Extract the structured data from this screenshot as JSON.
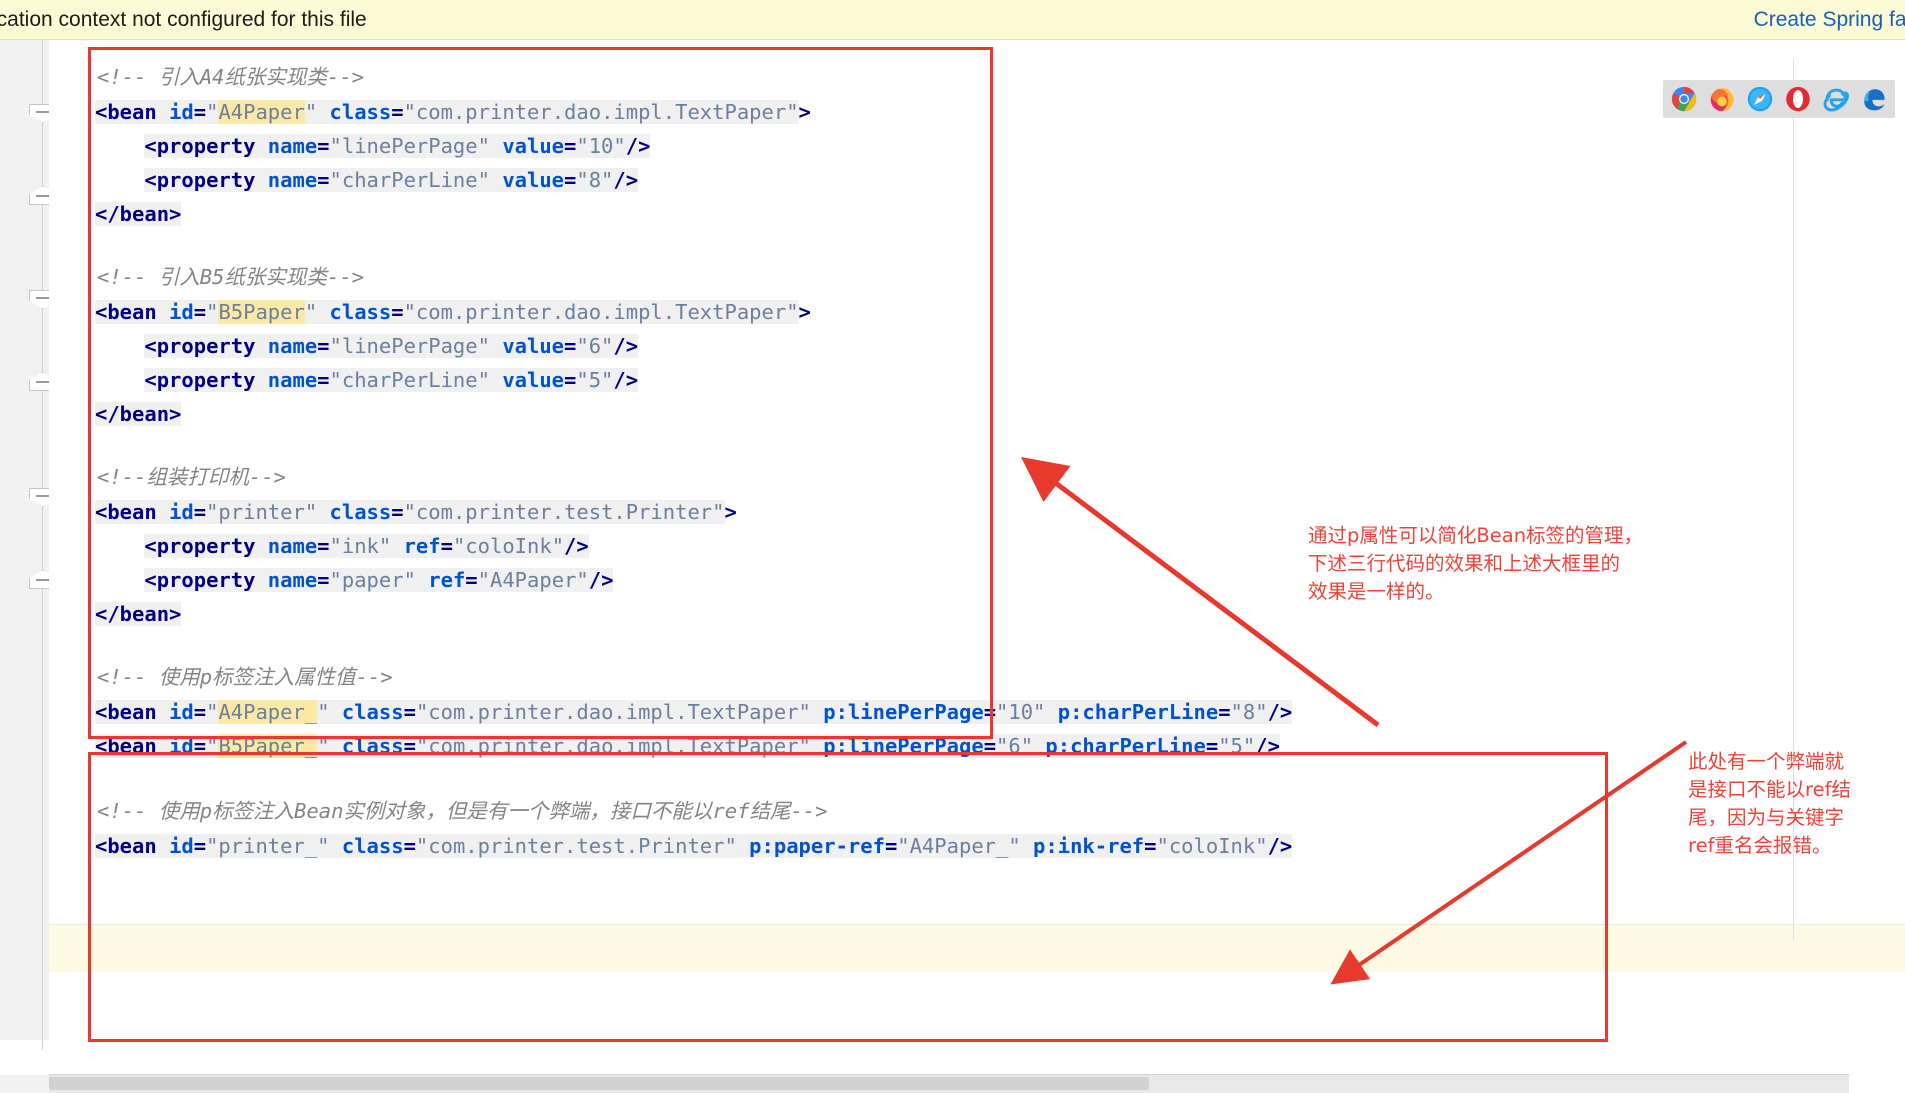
{
  "banner": {
    "message": "ication context not configured for this file",
    "action_link": "Create Spring fac"
  },
  "editor": {
    "language": "XML",
    "blocks": [
      {
        "name": "a4paper-bean",
        "comment": "<!-- 引入A4纸张实现类-->",
        "open_tag": "<bean ",
        "lines": [
          "<bean id=\"A4Paper\" class=\"com.printer.dao.impl.TextPaper\">",
          "    <property name=\"linePerPage\" value=\"10\"/>",
          "    <property name=\"charPerLine\" value=\"8\"/>",
          "</bean>"
        ]
      },
      {
        "name": "b5paper-bean",
        "comment": "<!-- 引入B5纸张实现类-->",
        "lines": [
          "<bean id=\"B5Paper\" class=\"com.printer.dao.impl.TextPaper\">",
          "    <property name=\"linePerPage\" value=\"6\"/>",
          "    <property name=\"charPerLine\" value=\"5\"/>",
          "</bean>"
        ]
      },
      {
        "name": "printer-bean",
        "comment": "<!--组装打印机-->",
        "lines": [
          "<bean id=\"printer\" class=\"com.printer.test.Printer\">",
          "    <property name=\"ink\" ref=\"coloInk\"/>",
          "    <property name=\"paper\" ref=\"A4Paper\"/>",
          "</bean>"
        ]
      },
      {
        "name": "p-namespace-beans",
        "comment": "<!-- 使用p标签注入属性值-->",
        "lines": [
          "<bean id=\"A4Paper_\" class=\"com.printer.dao.impl.TextPaper\" p:linePerPage=\"10\" p:charPerLine=\"8\"/>",
          "<bean id=\"B5Paper_\" class=\"com.printer.dao.impl.TextPaper\" p:linePerPage=\"6\" p:charPerLine=\"5\"/>"
        ]
      },
      {
        "name": "p-namespace-ref-bean",
        "comment": "<!-- 使用p标签注入Bean实例对象，但是有一个弊端，接口不能以ref结尾-->",
        "lines": [
          "<bean id=\"printer_\" class=\"com.printer.test.Printer\" p:paper-ref=\"A4Paper_\" p:ink-ref=\"coloInk\"/>"
        ]
      }
    ],
    "tokens": {
      "comment_a4": "<!-- 引入A4纸张实现类-->",
      "comment_b5": "<!-- 引入B5纸张实现类-->",
      "comment_printer": "<!--组装打印机-->",
      "comment_p_attr": "<!-- 使用p标签注入属性值-->",
      "comment_p_ref": "<!-- 使用p标签注入Bean实例对象，但是有一个弊端，接口不能以ref结尾-->",
      "bean_open": "<bean",
      "bean_close": "</bean>",
      "property_open": "<property",
      "attr_id": "id",
      "attr_class": "class",
      "attr_name": "name",
      "attr_value": "value",
      "attr_ref": "ref",
      "attr_p_linePerPage": "p:linePerPage",
      "attr_p_charPerLine": "p:charPerLine",
      "attr_p_paper_ref": "p:paper-ref",
      "attr_p_ink_ref": "p:ink-ref",
      "id_a4paper": "A4Paper",
      "id_b5paper": "B5Paper",
      "id_printer": "printer",
      "id_a4paper_u": "A4Paper_",
      "id_b5paper_u": "B5Paper_",
      "id_printer_u": "printer_",
      "class_textpaper": "com.printer.dao.impl.TextPaper",
      "class_printer": "com.printer.test.Printer",
      "val_10": "10",
      "val_8": "8",
      "val_6": "6",
      "val_5": "5",
      "ref_coloink": "coloInk",
      "name_linePerPage": "linePerPage",
      "name_charPerLine": "charPerLine",
      "name_ink": "ink",
      "name_paper": "paper",
      "selfclose": "/>",
      "gt": ">"
    }
  },
  "annotations": [
    {
      "name": "p-attribute-note",
      "text": "通过p属性可以简化Bean标签的管理，\n下述三行代码的效果和上述大框里的\n效果是一样的。"
    },
    {
      "name": "ref-suffix-warning",
      "text": "此处有一个弊端就\n是接口不能以ref结\n尾，因为与关键字\nref重名会报错。"
    }
  ],
  "browsers": [
    {
      "name": "chrome-icon",
      "label": "Chrome"
    },
    {
      "name": "firefox-icon",
      "label": "Firefox"
    },
    {
      "name": "safari-icon",
      "label": "Safari"
    },
    {
      "name": "opera-icon",
      "label": "Opera"
    },
    {
      "name": "internet-explorer-icon",
      "label": "Internet Explorer"
    },
    {
      "name": "edge-icon",
      "label": "Edge"
    }
  ],
  "colors": {
    "annotation_red": "#ee4338",
    "box_red": "#e8392e",
    "banner_yellow": "#fdfbd6",
    "link_blue": "#1a5fb4",
    "tag_navy": "#000080",
    "attr_blue": "#0052cf",
    "value_gray": "#6b7f9e",
    "comment_gray": "#848484",
    "highlight_yellow": "#fbe9a5",
    "caret_line": "#fdfbe4"
  }
}
